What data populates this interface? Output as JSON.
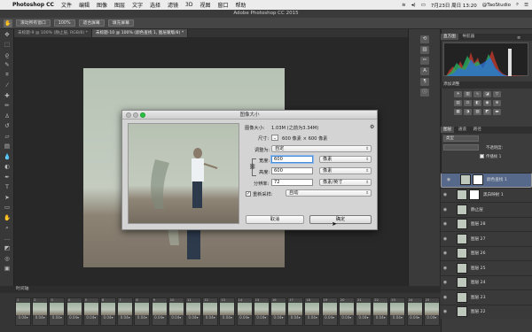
{
  "menubar": {
    "app_name": "Photoshop CC",
    "items": [
      "文件",
      "编辑",
      "图像",
      "图层",
      "文字",
      "选择",
      "滤镜",
      "3D",
      "视图",
      "窗口",
      "帮助"
    ],
    "clock": "7月23日 周日 13:20",
    "user": "@TaoStudio"
  },
  "window_title": "Adobe Photoshop CC 2015",
  "options_bar": {
    "btn1": "滚动所有窗口",
    "btn2": "100%",
    "btn3": "适合屏幕",
    "btn4": "填充屏幕"
  },
  "doc_tabs": [
    {
      "label": "未标题-9 @ 100% (静止层, RGB/8) *"
    },
    {
      "label": "未标题-10 @ 100% (颜色查找 1, 图层蒙版/8) *"
    }
  ],
  "dialog": {
    "title": "图像大小",
    "image_size_label": "图像大小:",
    "image_size_value": "1.03M (之前为3.34M)",
    "dimensions_label": "尺寸:",
    "dimensions_value": "600 像素 × 600 像素",
    "fit_label": "调整为:",
    "fit_value": "自定",
    "width_label": "宽度:",
    "width_value": "600",
    "width_unit": "像素",
    "height_label": "高度:",
    "height_value": "600",
    "height_unit": "像素",
    "resolution_label": "分辨率:",
    "resolution_value": "72",
    "resolution_unit": "像素/英寸",
    "resample_label": "重新采样:",
    "resample_value": "自动",
    "resample_checked": true,
    "cancel_label": "取消",
    "ok_label": "确定"
  },
  "panels": {
    "histogram_tabs": [
      "直方图",
      "导航器"
    ],
    "adjust_title": "添加调整",
    "layers_tabs": [
      "图层",
      "通道",
      "路径"
    ],
    "kind_label": "类型",
    "opacity_label": "不透明度:",
    "propagate_label": "传播帧 1",
    "layers": [
      {
        "name": "颜色查找 1",
        "selected": true,
        "mask": true
      },
      {
        "name": "黑白映射 1",
        "selected": false,
        "mask": true
      },
      {
        "name": "静止层",
        "selected": false,
        "mask": false
      },
      {
        "name": "图层 28",
        "selected": false,
        "mask": false
      },
      {
        "name": "图层 27",
        "selected": false,
        "mask": false
      },
      {
        "name": "图层 26",
        "selected": false,
        "mask": false
      },
      {
        "name": "图层 25",
        "selected": false,
        "mask": false
      },
      {
        "name": "图层 24",
        "selected": false,
        "mask": false
      },
      {
        "name": "图层 23",
        "selected": false,
        "mask": false
      },
      {
        "name": "图层 22",
        "selected": false,
        "mask": false
      }
    ]
  },
  "timeline": {
    "title": "时间轴",
    "frame_delay": "0.04▾",
    "frame_numbers": [
      "1",
      "2",
      "3",
      "4",
      "5",
      "6",
      "7",
      "8",
      "9",
      "10",
      "11",
      "12",
      "13",
      "14",
      "15",
      "16",
      "17",
      "18",
      "19",
      "20",
      "21",
      "22",
      "23",
      "24",
      "25"
    ]
  }
}
